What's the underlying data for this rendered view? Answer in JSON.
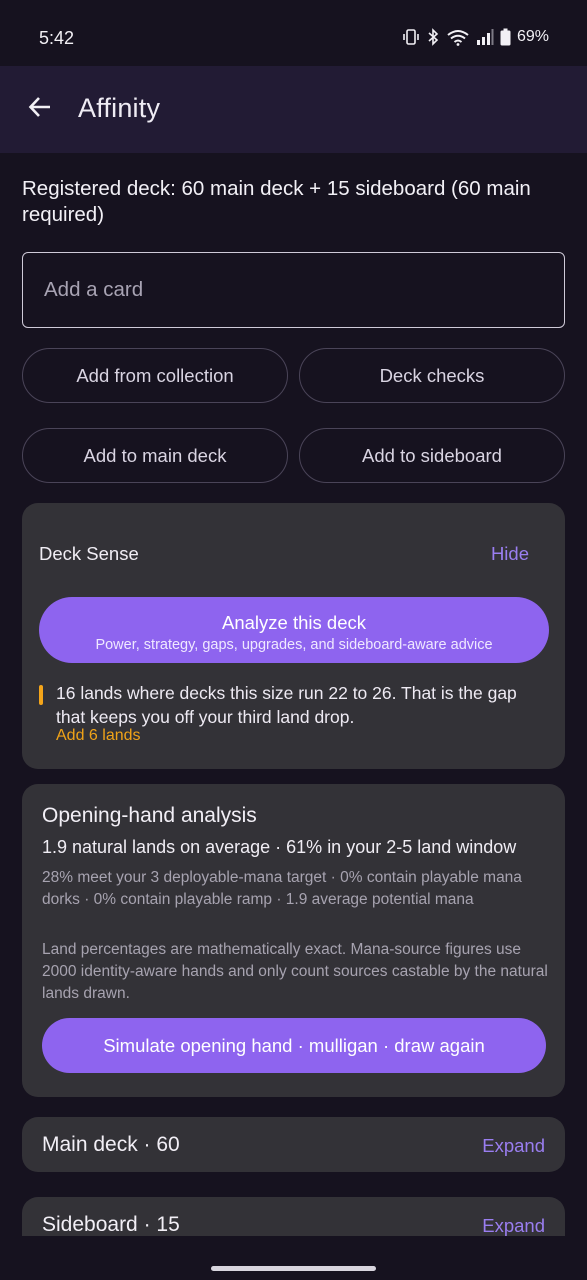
{
  "status_bar": {
    "time": "5:42",
    "battery": "69%",
    "icons": [
      "vibrate-icon",
      "bluetooth-icon",
      "wifi-icon",
      "signal-icon",
      "battery-icon"
    ]
  },
  "app_bar": {
    "title": "Affinity",
    "back_icon": "arrow-back-icon"
  },
  "registered_text": "Registered deck: 60 main deck + 15 sideboard (60 main required)",
  "add_card": {
    "placeholder": "Add a card",
    "value": ""
  },
  "buttons": {
    "add_from_collection": "Add from collection",
    "deck_checks": "Deck checks",
    "add_to_main": "Add to main deck",
    "add_to_sideboard": "Add to sideboard"
  },
  "deck_sense": {
    "title": "Deck Sense",
    "hide": "Hide",
    "analyze_title": "Analyze this deck",
    "analyze_subtitle": "Power, strategy, gaps, upgrades, and sideboard-aware advice",
    "warning_text": "16 lands where decks this size run 22 to 26. That is the gap that keeps you off your third land drop.",
    "warning_action": "Add 6 lands",
    "warning_color": "#f4a51a"
  },
  "opening_hand": {
    "title": "Opening-hand analysis",
    "summary": "1.9 natural lands on average · 61% in your 2-5 land window",
    "detail": "28% meet your 3 deployable-mana target · 0% contain playable mana dorks · 0% contain playable ramp · 1.9 average potential mana",
    "note": "Land percentages are mathematically exact. Mana-source figures use 2000 identity-aware hands and only count sources castable by the natural lands drawn.",
    "simulate": "Simulate opening hand · mulligan · draw again"
  },
  "sections": {
    "main_deck": {
      "title": "Main deck · 60",
      "action": "Expand"
    },
    "sideboard": {
      "title": "Sideboard · 15",
      "action": "Expand"
    }
  },
  "colors": {
    "accent": "#8e64ef",
    "link": "#9a7ef0",
    "warning": "#f0a318",
    "background": "#16121f",
    "app_bar": "#221b34",
    "card": "#333237"
  }
}
